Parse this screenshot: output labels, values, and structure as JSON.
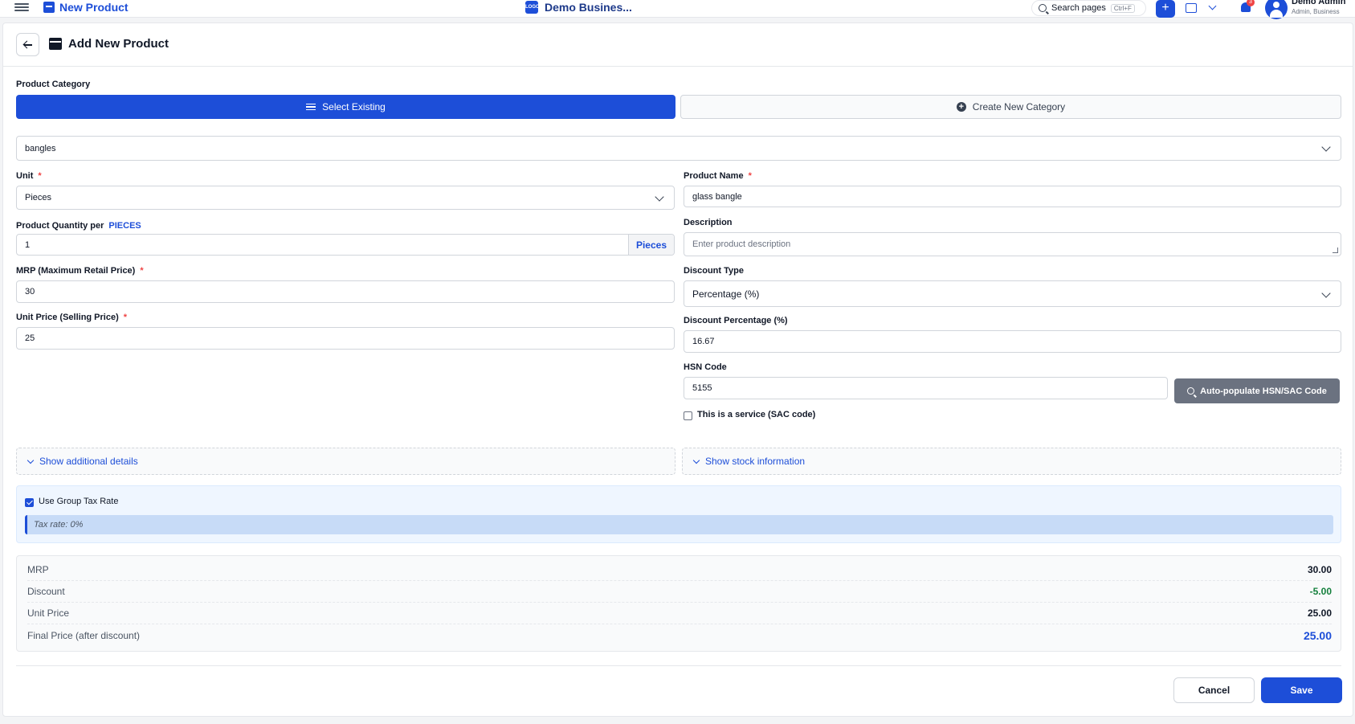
{
  "topbar": {
    "page_title": "New Product",
    "business_name": "Demo Busines...",
    "business_logo_text": "LOGO",
    "search_label": "Search pages",
    "search_shortcut": "Ctrl+F",
    "add_label": "+",
    "notification_count": "3",
    "user_name": "Demo Admin",
    "user_role": "Admin, Business"
  },
  "header": {
    "title": "Add New Product"
  },
  "category": {
    "label": "Product Category",
    "select_existing": "Select Existing",
    "create_new": "Create New Category",
    "selected": "bangles"
  },
  "form": {
    "unit": {
      "label": "Unit",
      "required": "*",
      "value": "Pieces"
    },
    "quantity": {
      "label": "Product Quantity per",
      "unit_word": "PIECES",
      "value": "1",
      "addon": "Pieces"
    },
    "mrp": {
      "label": "MRP (Maximum Retail Price)",
      "required": "*",
      "value": "30"
    },
    "unit_price": {
      "label": "Unit Price (Selling Price)",
      "required": "*",
      "value": "25"
    },
    "product_name": {
      "label": "Product Name",
      "required": "*",
      "value": "glass bangle"
    },
    "description": {
      "label": "Description",
      "placeholder": "Enter product description"
    },
    "discount_type": {
      "label": "Discount Type",
      "value": "Percentage (%)"
    },
    "discount_percentage": {
      "label": "Discount Percentage (%)",
      "value": "16.67"
    },
    "hsn": {
      "label": "HSN Code",
      "value": "5155",
      "auto_button": "Auto-populate HSN/SAC Code"
    },
    "service_checkbox": {
      "label": "This is a service (SAC code)",
      "checked": false
    }
  },
  "collapsibles": {
    "additional": "Show additional details",
    "stock": "Show stock information"
  },
  "tax": {
    "checkbox_label": "Use Group Tax Rate",
    "checked": true,
    "note": "Tax rate: 0%"
  },
  "summary": {
    "rows": [
      {
        "label": "MRP",
        "value": "30.00"
      },
      {
        "label": "Discount",
        "value": "-5.00"
      },
      {
        "label": "Unit Price",
        "value": "25.00"
      },
      {
        "label": "Final Price (after discount)",
        "value": "25.00"
      }
    ]
  },
  "actions": {
    "cancel": "Cancel",
    "save": "Save"
  },
  "colors": {
    "primary": "#1d4ed8",
    "danger": "#ef4444",
    "success": "#15803d"
  }
}
